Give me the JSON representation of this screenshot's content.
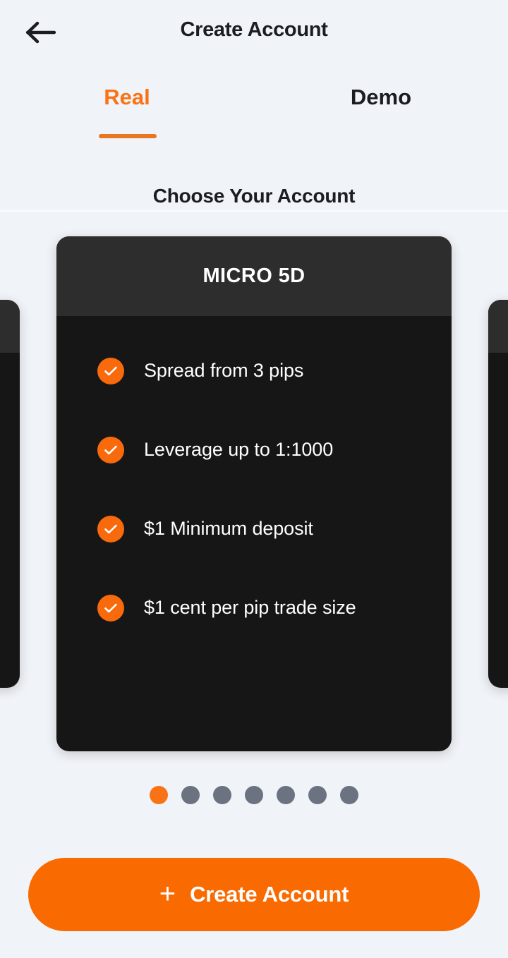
{
  "header": {
    "title": "Create Account",
    "back_icon": "arrow-left-icon"
  },
  "tabs": {
    "items": [
      {
        "label": "Real",
        "active": true
      },
      {
        "label": "Demo",
        "active": false
      }
    ],
    "accent_color": "#e8771f"
  },
  "main": {
    "section_title": "Choose Your Account",
    "card": {
      "title": "MICRO 5D",
      "header_bg": "#2d2d2d",
      "body_bg": "#161616",
      "features": [
        {
          "icon": "check-circle-icon",
          "text": "Spread from 3 pips"
        },
        {
          "icon": "check-circle-icon",
          "text": "Leverage up to 1:1000"
        },
        {
          "icon": "check-circle-icon",
          "text": "$1 Minimum deposit"
        },
        {
          "icon": "check-circle-icon",
          "text": "$1 cent per pip trade size"
        }
      ]
    },
    "pagination": {
      "total": 7,
      "active_index": 0,
      "active_color": "#f97316",
      "inactive_color": "#6b7280"
    }
  },
  "footer": {
    "cta_plus": "+",
    "cta_label": "Create Account",
    "cta_color": "#f96a00"
  }
}
